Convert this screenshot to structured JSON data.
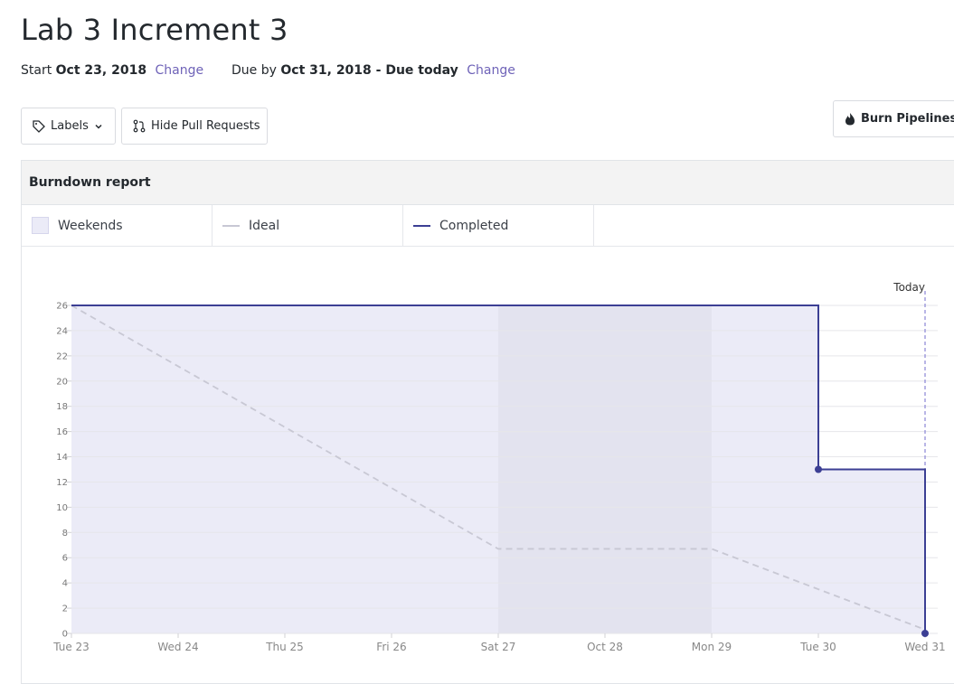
{
  "page": {
    "title": "Lab 3 Increment 3",
    "start_label": "Start",
    "start_date": "Oct 23, 2018",
    "start_change": "Change",
    "due_label": "Due by",
    "due_date": "Oct 31, 2018 - Due today",
    "due_change": "Change"
  },
  "toolbar": {
    "labels_button": "Labels",
    "hide_pr_button": "Hide Pull Requests",
    "burn_button": "Burn Pipelines"
  },
  "report": {
    "title": "Burndown report",
    "legend": {
      "weekends": "Weekends",
      "ideal": "Ideal",
      "completed": "Completed"
    },
    "today_label": "Today"
  },
  "colors": {
    "completed": "#3c3f94",
    "ideal": "#c8c8d4",
    "area": "#ebebf7",
    "weekend": "#e3e3ef",
    "today": "#8b86d6",
    "link": "#6f63b8"
  },
  "chart_data": {
    "type": "line",
    "title": "Burndown report",
    "x": [
      "Tue 23",
      "Wed 24",
      "Thu 25",
      "Fri 26",
      "Sat 27",
      "Oct 28",
      "Mon 29",
      "Tue 30",
      "Wed 31"
    ],
    "ylim": [
      0,
      26
    ],
    "yticks": [
      0,
      2,
      4,
      6,
      8,
      10,
      12,
      14,
      16,
      18,
      20,
      22,
      24,
      26
    ],
    "weekend_range": [
      "Sat 27",
      "Mon 29"
    ],
    "today": "Wed 31",
    "grid": true,
    "series": [
      {
        "name": "Ideal",
        "style": "dashed",
        "points": [
          [
            0,
            26
          ],
          [
            4,
            6.7
          ],
          [
            6,
            6.7
          ],
          [
            8,
            0.3
          ]
        ]
      },
      {
        "name": "Completed",
        "style": "step",
        "points": [
          [
            0,
            26
          ],
          [
            7,
            26
          ],
          [
            7,
            13
          ],
          [
            8,
            13
          ],
          [
            8,
            0
          ]
        ],
        "markers": [
          [
            7,
            13
          ],
          [
            8,
            0
          ]
        ]
      }
    ]
  }
}
